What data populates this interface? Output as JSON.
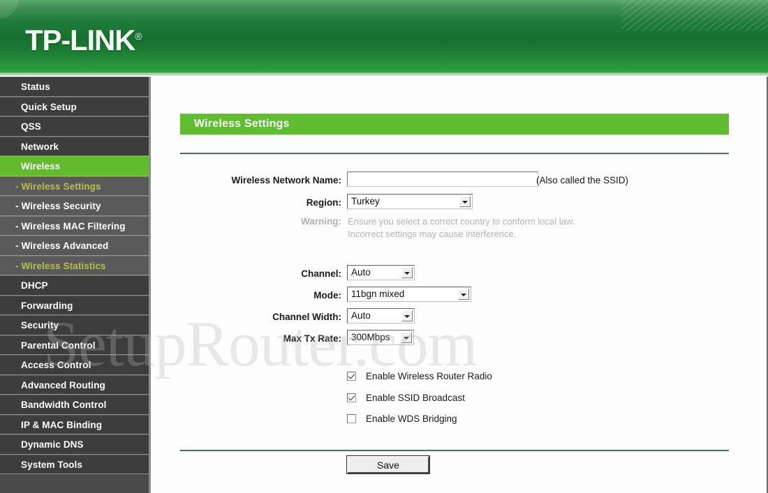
{
  "header": {
    "logo_text": "TP-LINK",
    "logo_reg": "®"
  },
  "sidebar": {
    "items": [
      {
        "label": "Status",
        "level": "top",
        "state": "normal"
      },
      {
        "label": "Quick Setup",
        "level": "top",
        "state": "normal"
      },
      {
        "label": "QSS",
        "level": "top",
        "state": "normal"
      },
      {
        "label": "Network",
        "level": "top",
        "state": "normal"
      },
      {
        "label": "Wireless",
        "level": "top",
        "state": "active"
      },
      {
        "label": "- Wireless Settings",
        "level": "sub",
        "state": "visited"
      },
      {
        "label": "- Wireless Security",
        "level": "sub",
        "state": "normal"
      },
      {
        "label": "- Wireless MAC Filtering",
        "level": "sub",
        "state": "normal"
      },
      {
        "label": "- Wireless Advanced",
        "level": "sub",
        "state": "normal"
      },
      {
        "label": "- Wireless Statistics",
        "level": "sub",
        "state": "visited"
      },
      {
        "label": "DHCP",
        "level": "top",
        "state": "normal"
      },
      {
        "label": "Forwarding",
        "level": "top",
        "state": "normal"
      },
      {
        "label": "Security",
        "level": "top",
        "state": "normal"
      },
      {
        "label": "Parental Control",
        "level": "top",
        "state": "normal"
      },
      {
        "label": "Access Control",
        "level": "top",
        "state": "normal"
      },
      {
        "label": "Advanced Routing",
        "level": "top",
        "state": "normal"
      },
      {
        "label": "Bandwidth Control",
        "level": "top",
        "state": "normal"
      },
      {
        "label": "IP & MAC Binding",
        "level": "top",
        "state": "normal"
      },
      {
        "label": "Dynamic DNS",
        "level": "top",
        "state": "normal"
      },
      {
        "label": "System Tools",
        "level": "top",
        "state": "normal"
      }
    ]
  },
  "main": {
    "panel_title": "Wireless Settings",
    "fields": {
      "ssid_label": "Wireless Network Name:",
      "ssid_value": "",
      "ssid_hint": "(Also called the SSID)",
      "region_label": "Region:",
      "region_value": "Turkey",
      "warning_label": "Warning:",
      "warning_line1": "Ensure you select a correct country to conform local law.",
      "warning_line2": "Incorrect settings may cause interference.",
      "channel_label": "Channel:",
      "channel_value": "Auto",
      "mode_label": "Mode:",
      "mode_value": "11bgn mixed",
      "channel_width_label": "Channel Width:",
      "channel_width_value": "Auto",
      "max_tx_rate_label": "Max Tx Rate:",
      "max_tx_rate_value": "300Mbps"
    },
    "checkboxes": [
      {
        "label": "Enable Wireless Router Radio",
        "checked": true
      },
      {
        "label": "Enable SSID Broadcast",
        "checked": true
      },
      {
        "label": "Enable WDS Bridging",
        "checked": false
      }
    ],
    "save_label": "Save"
  },
  "watermark": {
    "text": "SetupRouter.com"
  },
  "colors": {
    "header_green": "#1c7a39",
    "accent_green": "#60bd32",
    "sidebar_dark": "#3d3d3d",
    "sidebar_sub": "#5a5a5a",
    "visited_olive": "#b9bf4e"
  }
}
